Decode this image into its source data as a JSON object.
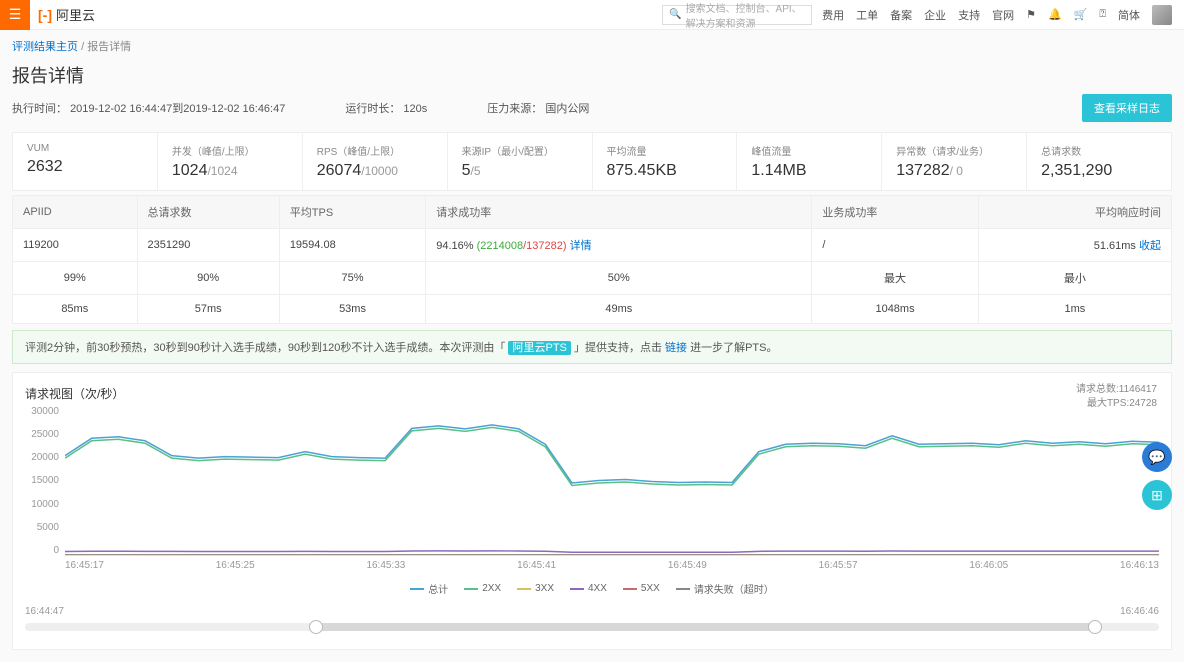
{
  "header": {
    "logo_text": "阿里云",
    "search_placeholder": "搜索文档、控制台、API、解决方案和资源",
    "nav": [
      "费用",
      "工单",
      "备案",
      "企业",
      "支持",
      "官网"
    ],
    "lang": "简体"
  },
  "breadcrumb": {
    "home": "评测结果主页",
    "current": "报告详情"
  },
  "title": "报告详情",
  "meta": {
    "exec_time_label": "执行时间：",
    "exec_time_value": "2019-12-02 16:44:47到2019-12-02 16:46:47",
    "run_duration_label": "运行时长：",
    "run_duration_value": "120s",
    "pressure_source_label": "压力来源：",
    "pressure_source_value": "国内公网",
    "view_log_btn": "查看采样日志"
  },
  "stats": [
    {
      "label": "VUM",
      "value": "2632"
    },
    {
      "label": "并发（峰值/上限）",
      "value": "1024",
      "sub": "/1024"
    },
    {
      "label": "RPS（峰值/上限）",
      "value": "26074",
      "sub": "/10000"
    },
    {
      "label": "来源IP（最小/配置）",
      "value": "5",
      "sub": "/5"
    },
    {
      "label": "平均流量",
      "value": "875.45KB"
    },
    {
      "label": "峰值流量",
      "value": "1.14MB"
    },
    {
      "label": "异常数（请求/业务）",
      "value": "137282",
      "sub": "/ 0"
    },
    {
      "label": "总请求数",
      "value": "2,351,290"
    }
  ],
  "table": {
    "headers": [
      "APIID",
      "总请求数",
      "平均TPS",
      "请求成功率",
      "业务成功率",
      "平均响应时间"
    ],
    "row": {
      "api_id": "119200",
      "total": "2351290",
      "tps": "19594.08",
      "success_rate": "94.16%",
      "success_ok": "(2214008",
      "success_fail": "/137282)",
      "detail_link": "详情",
      "biz_rate": "/",
      "avg_rt": "51.61ms",
      "collapse": "收起"
    },
    "percent_header_max": "最大",
    "percent_header_min": "最小",
    "percentiles": [
      {
        "p": "99%",
        "v": "85ms"
      },
      {
        "p": "90%",
        "v": "57ms"
      },
      {
        "p": "75%",
        "v": "53ms"
      },
      {
        "p": "50%",
        "v": "49ms"
      },
      {
        "p_label": "最大",
        "p": "",
        "v": "1048ms"
      },
      {
        "p_label": "最小",
        "p": "",
        "v": "1ms"
      }
    ]
  },
  "tip": {
    "text_before": "评测2分钟，前30秒预热，30秒到90秒计入选手成绩，90秒到120秒不计入选手成绩。本次评测由「",
    "badge": "阿里云PTS",
    "text_mid": "」提供支持，点击",
    "link": "链接",
    "text_after": "进一步了解PTS。"
  },
  "chart": {
    "title": "请求视图（次/秒）",
    "meta1_label": "请求总数:",
    "meta1_value": "1146417",
    "meta2_label": "最大TPS:",
    "meta2_value": "24728"
  },
  "chart_data": {
    "type": "line",
    "ylim": [
      0,
      30000
    ],
    "y_ticks": [
      30000,
      25000,
      20000,
      15000,
      10000,
      5000,
      0
    ],
    "x_ticks": [
      "16:45:17",
      "16:45:25",
      "16:45:33",
      "16:45:41",
      "16:45:49",
      "16:45:57",
      "16:46:05",
      "16:46:13"
    ],
    "series": [
      {
        "name": "总计",
        "color": "#4aa3d4",
        "values": [
          20000,
          23500,
          23800,
          23000,
          20000,
          19500,
          19800,
          19700,
          19600,
          20800,
          19800,
          19600,
          19500,
          25500,
          26000,
          25400,
          26200,
          25400,
          22300,
          14500,
          15000,
          15200,
          14800,
          14600,
          14700,
          14600,
          20800,
          22300,
          22500,
          22400,
          22000,
          24000,
          22300,
          22400,
          22500,
          22200,
          23000,
          22500,
          22800,
          22400,
          22900,
          22700
        ]
      },
      {
        "name": "2XX",
        "color": "#5bbf8a",
        "values": [
          19500,
          23000,
          23300,
          22500,
          19500,
          19000,
          19300,
          19200,
          19100,
          20300,
          19300,
          19100,
          19000,
          25000,
          25500,
          24900,
          25700,
          24900,
          21800,
          14000,
          14500,
          14700,
          14300,
          14100,
          14200,
          14100,
          20300,
          21800,
          22000,
          21900,
          21500,
          23500,
          21800,
          21900,
          22000,
          21700,
          22500,
          22000,
          22300,
          21900,
          22400,
          22200
        ]
      },
      {
        "name": "3XX",
        "color": "#d5c25a",
        "values": [
          0,
          0,
          0,
          0,
          0,
          0,
          0,
          0,
          0,
          0,
          0,
          0,
          0,
          0,
          0,
          0,
          0,
          0,
          0,
          0,
          0,
          0,
          0,
          0,
          0,
          0,
          0,
          0,
          0,
          0,
          0,
          0,
          0,
          0,
          0,
          0,
          0,
          0,
          0,
          0,
          0,
          0
        ]
      },
      {
        "name": "4XX",
        "color": "#8a6bbd",
        "values": [
          700,
          750,
          760,
          740,
          720,
          710,
          715,
          712,
          710,
          740,
          715,
          710,
          708,
          800,
          820,
          810,
          830,
          810,
          760,
          550,
          560,
          565,
          555,
          550,
          553,
          550,
          740,
          770,
          780,
          775,
          765,
          800,
          770,
          775,
          780,
          770,
          790,
          778,
          785,
          775,
          788,
          783
        ]
      },
      {
        "name": "5XX",
        "color": "#c96a6a",
        "values": [
          0,
          0,
          0,
          0,
          0,
          0,
          0,
          0,
          0,
          0,
          0,
          0,
          0,
          0,
          0,
          0,
          0,
          0,
          0,
          0,
          0,
          0,
          0,
          0,
          0,
          0,
          0,
          0,
          0,
          0,
          0,
          0,
          0,
          0,
          0,
          0,
          0,
          0,
          0,
          0,
          0,
          0
        ]
      },
      {
        "name": "请求失败（超时）",
        "color": "#888888",
        "values": [
          0,
          0,
          0,
          0,
          0,
          0,
          0,
          0,
          0,
          0,
          0,
          0,
          0,
          0,
          0,
          0,
          0,
          0,
          0,
          0,
          0,
          0,
          0,
          0,
          0,
          0,
          0,
          0,
          0,
          0,
          0,
          0,
          0,
          0,
          0,
          0,
          0,
          0,
          0,
          0,
          0,
          0
        ]
      }
    ]
  },
  "time_range": {
    "start": "16:44:47",
    "end": "16:46:46"
  }
}
